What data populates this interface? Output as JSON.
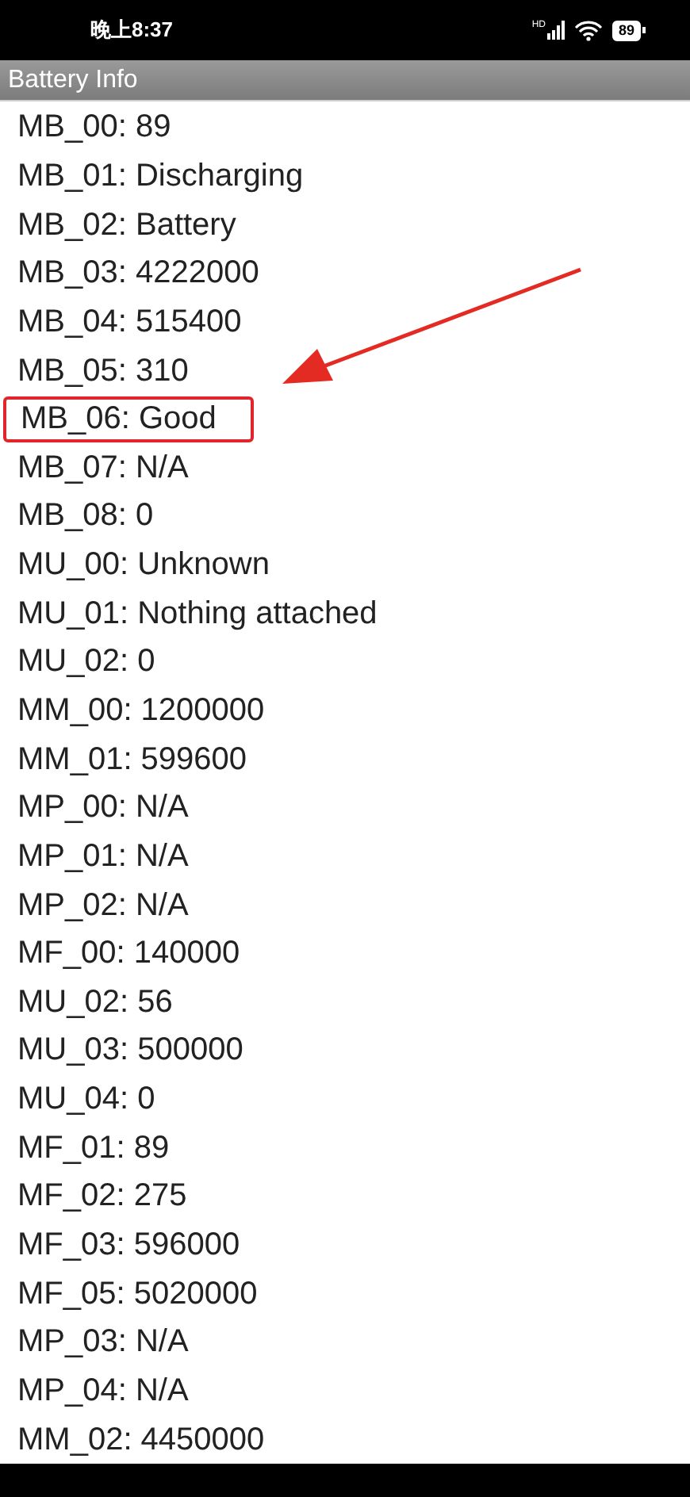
{
  "status_bar": {
    "time": "晚上8:37",
    "network": "HD",
    "battery": "89"
  },
  "title_bar": {
    "title": "Battery Info"
  },
  "items": [
    {
      "text": "MB_00: 89",
      "highlighted": false
    },
    {
      "text": "MB_01: Discharging",
      "highlighted": false
    },
    {
      "text": "MB_02: Battery",
      "highlighted": false
    },
    {
      "text": "MB_03: 4222000",
      "highlighted": false
    },
    {
      "text": "MB_04: 515400",
      "highlighted": false
    },
    {
      "text": "MB_05: 310",
      "highlighted": false
    },
    {
      "text": "MB_06: Good",
      "highlighted": true
    },
    {
      "text": "MB_07: N/A",
      "highlighted": false
    },
    {
      "text": "MB_08: 0",
      "highlighted": false
    },
    {
      "text": "MU_00: Unknown",
      "highlighted": false
    },
    {
      "text": "MU_01: Nothing attached",
      "highlighted": false
    },
    {
      "text": "MU_02: 0",
      "highlighted": false
    },
    {
      "text": "MM_00: 1200000",
      "highlighted": false
    },
    {
      "text": "MM_01: 599600",
      "highlighted": false
    },
    {
      "text": "MP_00: N/A",
      "highlighted": false
    },
    {
      "text": "MP_01: N/A",
      "highlighted": false
    },
    {
      "text": "MP_02: N/A",
      "highlighted": false
    },
    {
      "text": "MF_00: 140000",
      "highlighted": false
    },
    {
      "text": "MU_02: 56",
      "highlighted": false
    },
    {
      "text": "MU_03: 500000",
      "highlighted": false
    },
    {
      "text": "MU_04: 0",
      "highlighted": false
    },
    {
      "text": "MF_01: 89",
      "highlighted": false
    },
    {
      "text": "MF_02: 275",
      "highlighted": false
    },
    {
      "text": "MF_03: 596000",
      "highlighted": false
    },
    {
      "text": "MF_05: 5020000",
      "highlighted": false
    },
    {
      "text": "MP_03: N/A",
      "highlighted": false
    },
    {
      "text": "MP_04: N/A",
      "highlighted": false
    },
    {
      "text": "MM_02: 4450000",
      "highlighted": false
    }
  ]
}
